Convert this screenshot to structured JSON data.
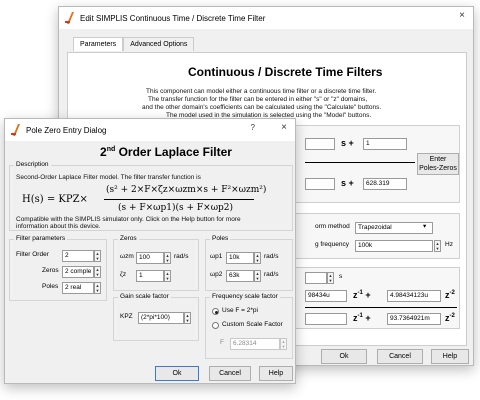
{
  "back_window": {
    "title": "Edit SIMPLIS Continuous Time / Discrete Time Filter",
    "close": "×",
    "tabs": [
      "Parameters",
      "Advanced Options"
    ],
    "heading": "Continuous / Discrete Time Filters",
    "description_lines": [
      "This component can model either a continuous time filter or a discrete time filter.",
      "The transfer function for the filter can be entered in either \"s\" or \"z\" domains,",
      "and the other domain's coefficients can be calculated using the \"Calculate\" buttons.",
      "The model used in the simulation is selected using the \"Model\" buttons."
    ],
    "s_plus": "s +",
    "num_coef": "1",
    "den_coef": "628.319",
    "enter_poles_zeros_line1": "Enter",
    "enter_poles_zeros_line2": "Poles-Zeros",
    "transform_method_label": "orm method",
    "transform_method_value": "Trapezoidal",
    "sampling_freq_label": "g frequency",
    "sampling_freq_value": "100k",
    "hz": "Hz",
    "s_unit": "s",
    "z_coef1": "98434u",
    "z_coef2": "4.98434123u",
    "z_coef3": "93.7364921m",
    "z1": "z",
    "z1_exp": "-1",
    "z2_exp": "-2",
    "plus": "+",
    "ok": "Ok",
    "cancel": "Cancel",
    "help": "Help"
  },
  "front_window": {
    "title": "Pole Zero Entry Dialog",
    "help_q": "?",
    "close": "×",
    "heading_prefix": "2",
    "heading_sup": "nd",
    "heading_rest": " Order Laplace Filter",
    "description_group": "Description",
    "description_text": "Second-Order Laplace Filter model. The filter transfer function is",
    "formula_lhs": "H(s) = KPZ×",
    "formula_num": "(s² + 2×F×ζz×ωzm×s + F²×ωzm²)",
    "formula_den": "(s + F×ωp1)(s + F×ωp2)",
    "compat_line1": "Compatible with the SIMPLIS simulator only. Click on the Help button for more",
    "compat_line2": "information about this device.",
    "filter_params": {
      "title": "Filter parameters",
      "order_label": "Filter Order",
      "order_value": "2",
      "zeros_label": "Zeros",
      "zeros_value": "2 comple",
      "poles_label": "Poles",
      "poles_value": "2 real"
    },
    "zeros_group": {
      "title": "Zeros",
      "wzm_label": "ωzm",
      "wzm_value": "100",
      "wzm_unit": "rad/s",
      "zeta_label": "ζz",
      "zeta_value": "1"
    },
    "poles_group": {
      "title": "Poles",
      "wp1_label": "ωp1",
      "wp1_value": "10k",
      "wp1_unit": "rad/s",
      "wp2_label": "ωp2",
      "wp2_value": "63k",
      "wp2_unit": "rad/s"
    },
    "gain_group": {
      "title": "Gain scale factor",
      "kpz_label": "KPZ",
      "kpz_value": "(2*pi*100)"
    },
    "freq_group": {
      "title": "Frequency scale factor",
      "opt1": "Use F = 2*pi",
      "opt2": "Custom Scale Factor",
      "f_label": "F",
      "f_value": "6.28314"
    },
    "ok": "Ok",
    "cancel": "Cancel",
    "help": "Help"
  }
}
